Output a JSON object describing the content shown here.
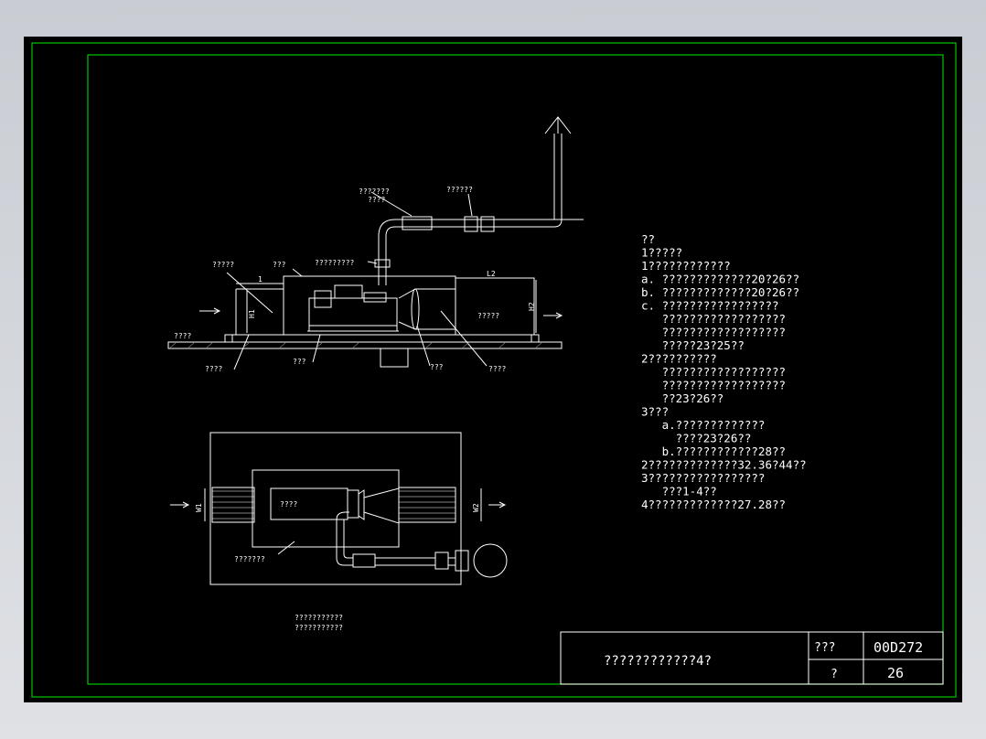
{
  "drawing": {
    "elevation_labels": {
      "top_left_1": "???????",
      "top_left_2": "????",
      "top_right": "??????",
      "mid_label": "?????????",
      "left_label": "?????",
      "small_label": "???",
      "ground_label": "????",
      "bottom_left": "????",
      "bottom_mid": "???",
      "bottom_mid2": "???",
      "bottom_right": "????",
      "muffler_label": "?????",
      "dim_h1": "H1",
      "dim_h2": "H2",
      "dim_l1": "1",
      "dim_l2": "L2"
    },
    "plan_labels": {
      "engine": "????",
      "room": "???????",
      "dim_w1": "W1",
      "dim_w2": "W2"
    },
    "caption_line1": "???????????",
    "caption_line2": "???????????"
  },
  "notes": [
    "??",
    "1?????",
    "1????????????",
    "a. ?????????????20?26??",
    "b. ?????????????20?26??",
    "c. ?????????????????",
    "   ??????????????????",
    "   ??????????????????",
    "   ?????23?25??",
    "2??????????",
    "   ??????????????????",
    "   ??????????????????",
    "   ??23?26??",
    "3???",
    "   a.?????????????",
    "     ????23?26??",
    "   b.????????????28??",
    "2?????????????32.36?44??",
    "3?????????????????",
    "   ???1-4??",
    "4?????????????27.28??"
  ],
  "title_block": {
    "title": "????????????4?",
    "label_set": "???",
    "set_number": "00D272",
    "label_page": "?",
    "page_number": "26"
  },
  "colors": {
    "background": "#000000",
    "frame_green": "#00c800",
    "lines": "#ffffff"
  }
}
